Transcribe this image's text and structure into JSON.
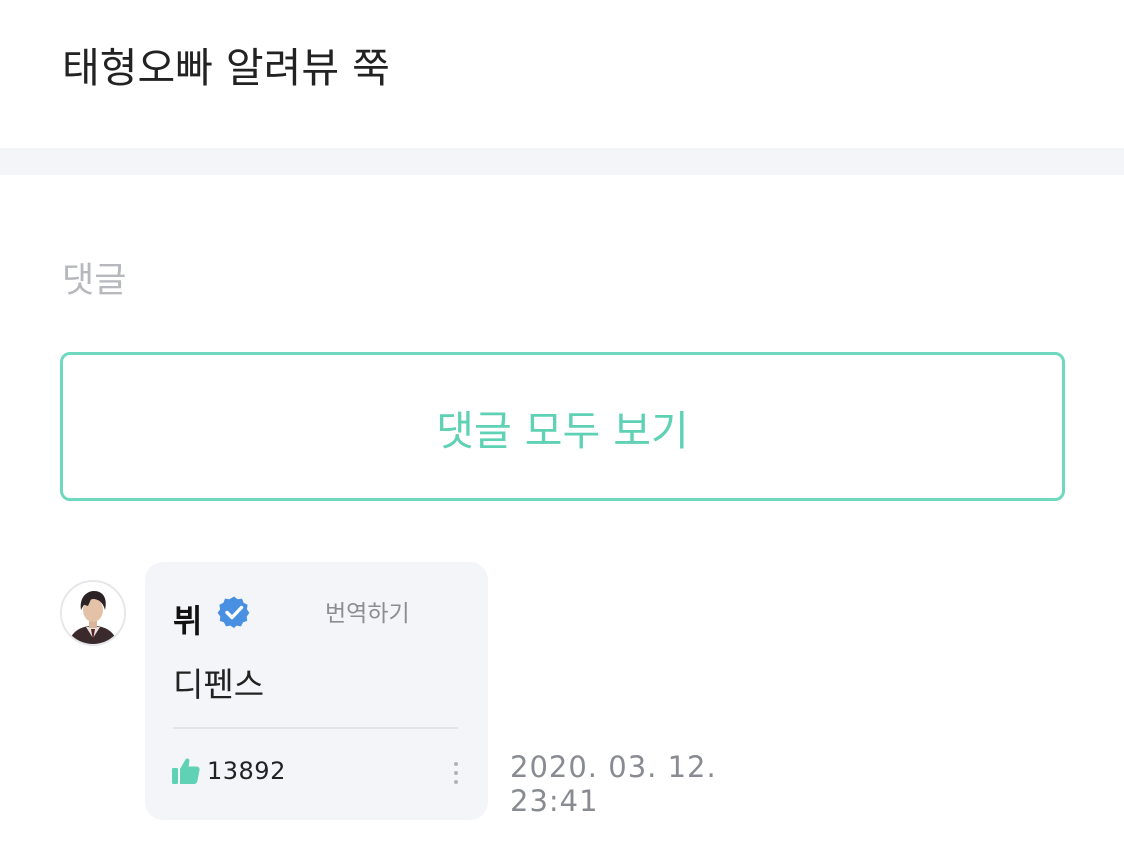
{
  "post": {
    "title": "태형오빠 알려뷰 쭉"
  },
  "comments_section": {
    "heading": "댓글",
    "view_all_label": "댓글 모두 보기"
  },
  "comment": {
    "author": "뷔",
    "verified_icon": "verified-badge-icon",
    "translate_label": "번역하기",
    "text": "디펜스",
    "like_icon": "thumbs-up-icon",
    "like_count": "13892",
    "more_icon": "vertical-ellipsis-icon",
    "date": "2020. 03. 12.",
    "time": "23:41"
  },
  "colors": {
    "accent": "#5fd1b4",
    "accent_border": "#6fd9c0",
    "verified": "#4a90e2",
    "bubble_bg": "#f4f5f8",
    "muted_text": "#8a8d93"
  }
}
